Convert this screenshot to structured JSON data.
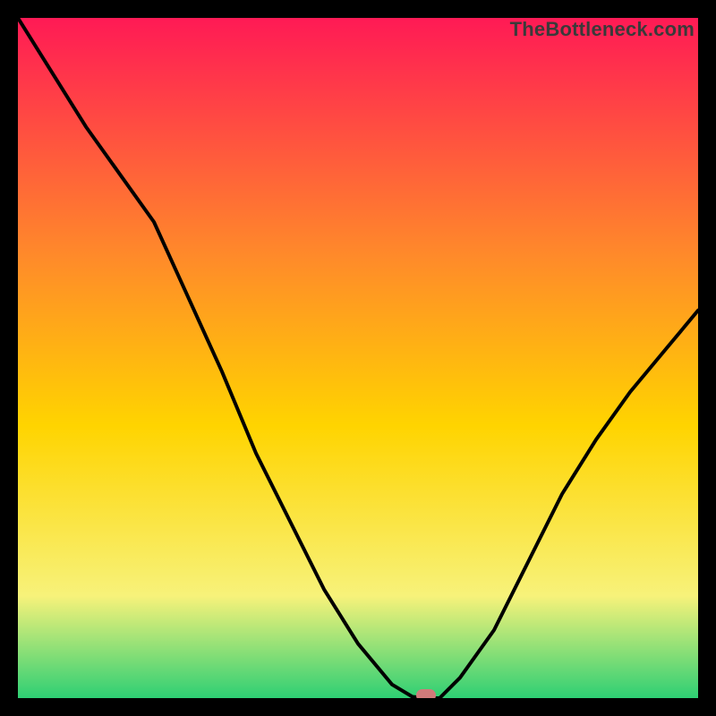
{
  "watermark": "TheBottleneck.com",
  "colors": {
    "gradient_top": "#ff1a55",
    "gradient_mid_upper": "#ff8a2a",
    "gradient_mid": "#ffd400",
    "gradient_lower": "#f7f27a",
    "gradient_bottom": "#2ecf74",
    "curve": "#000000",
    "marker": "#d17a7a",
    "frame": "#000000"
  },
  "chart_data": {
    "type": "line",
    "title": "",
    "xlabel": "",
    "ylabel": "",
    "xlim": [
      0,
      100
    ],
    "ylim": [
      0,
      100
    ],
    "x": [
      0,
      5,
      10,
      15,
      20,
      25,
      30,
      35,
      40,
      45,
      50,
      55,
      58,
      60,
      62,
      65,
      70,
      75,
      80,
      85,
      90,
      95,
      100
    ],
    "values": [
      100,
      92,
      84,
      77,
      70,
      59,
      48,
      36,
      26,
      16,
      8,
      2,
      0.2,
      0,
      0,
      3,
      10,
      20,
      30,
      38,
      45,
      51,
      57
    ],
    "marker": {
      "x": 60,
      "y": 0
    },
    "annotations": []
  }
}
